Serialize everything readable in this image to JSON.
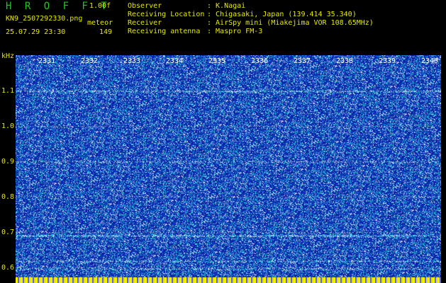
{
  "header": {
    "app_title": "H R O F F T",
    "version": "1.00f",
    "filename": "KN9_2507292330.png",
    "meteor_label": "meteor",
    "datetime": "25.07.29 23:30",
    "meteor_count": "149"
  },
  "info": [
    {
      "key": "Observer",
      "value": ": K.Nagai"
    },
    {
      "key": "Receiving Location",
      "value": ": Chigasaki, Japan (139.414 35.340)"
    },
    {
      "key": "Receiver",
      "value": ": AirSpy mini (Miakejima VOR 108.65MHz)"
    },
    {
      "key": "Receiving antenna",
      "value": ": Maspro FM-3"
    }
  ],
  "axis": {
    "y_unit": "kHz",
    "y_ticks": [
      "1.1",
      "1.0",
      "0.9",
      "0.8",
      "0.7",
      "0.6"
    ],
    "x_ticks": [
      "2331",
      "2332",
      "2333",
      "2334",
      "2335",
      "2336",
      "2337",
      "2338",
      "2339",
      "2340"
    ]
  },
  "colors": {
    "background": "#000000",
    "text": "#e8e800",
    "title": "#1fc820",
    "spectrogram_base": "#0b18a8"
  }
}
